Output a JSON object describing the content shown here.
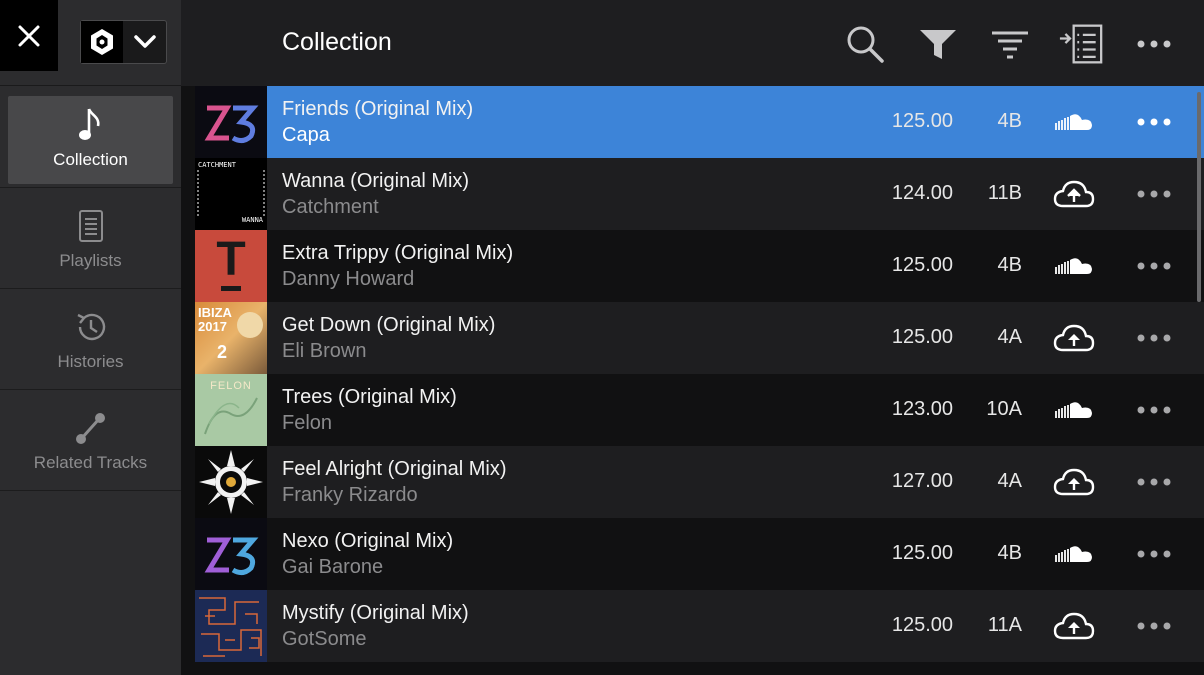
{
  "sidebar": {
    "close_icon": "close-icon",
    "device_icon": "rekordbox-logo-icon",
    "items": [
      {
        "label": "Collection",
        "icon": "music-note-icon",
        "active": true
      },
      {
        "label": "Playlists",
        "icon": "playlist-icon",
        "active": false
      },
      {
        "label": "Histories",
        "icon": "history-icon",
        "active": false
      },
      {
        "label": "Related Tracks",
        "icon": "related-tracks-icon",
        "active": false
      }
    ]
  },
  "header": {
    "title": "Collection",
    "icons": [
      "search-icon",
      "filter-icon",
      "sort-icon",
      "add-to-list-icon",
      "more-icon"
    ]
  },
  "tracks": [
    {
      "title": "Friends (Original Mix)",
      "artist": "Capa",
      "bpm": "125.00",
      "key": "4B",
      "cloud": "soundcloud",
      "selected": true
    },
    {
      "title": "Wanna (Original Mix)",
      "artist": "Catchment",
      "bpm": "124.00",
      "key": "11B",
      "cloud": "upload",
      "selected": false
    },
    {
      "title": "Extra Trippy (Original Mix)",
      "artist": "Danny Howard",
      "bpm": "125.00",
      "key": "4B",
      "cloud": "soundcloud",
      "selected": false
    },
    {
      "title": "Get Down (Original Mix)",
      "artist": "Eli Brown",
      "bpm": "125.00",
      "key": "4A",
      "cloud": "upload",
      "selected": false
    },
    {
      "title": "Trees (Original Mix)",
      "artist": "Felon",
      "bpm": "123.00",
      "key": "10A",
      "cloud": "soundcloud",
      "selected": false
    },
    {
      "title": "Feel Alright (Original Mix)",
      "artist": "Franky Rizardo",
      "bpm": "127.00",
      "key": "4A",
      "cloud": "upload",
      "selected": false
    },
    {
      "title": "Nexo (Original Mix)",
      "artist": "Gai Barone",
      "bpm": "125.00",
      "key": "4B",
      "cloud": "soundcloud",
      "selected": false
    },
    {
      "title": "Mystify (Original Mix)",
      "artist": "GotSome",
      "bpm": "125.00",
      "key": "11A",
      "cloud": "upload",
      "selected": false
    }
  ],
  "artwork_labels": {
    "wanna_top": "CATCHMENT",
    "wanna_bottom": "WANNA",
    "get_down": "IBIZA 2017",
    "get_down_num": "2",
    "trees": "FELON",
    "extra_trippy": "T"
  },
  "colors": {
    "selected_row": "#3d84d8",
    "row_dark": "#111112",
    "row_alt": "#1e1e20",
    "sidebar": "#2c2c2e"
  }
}
